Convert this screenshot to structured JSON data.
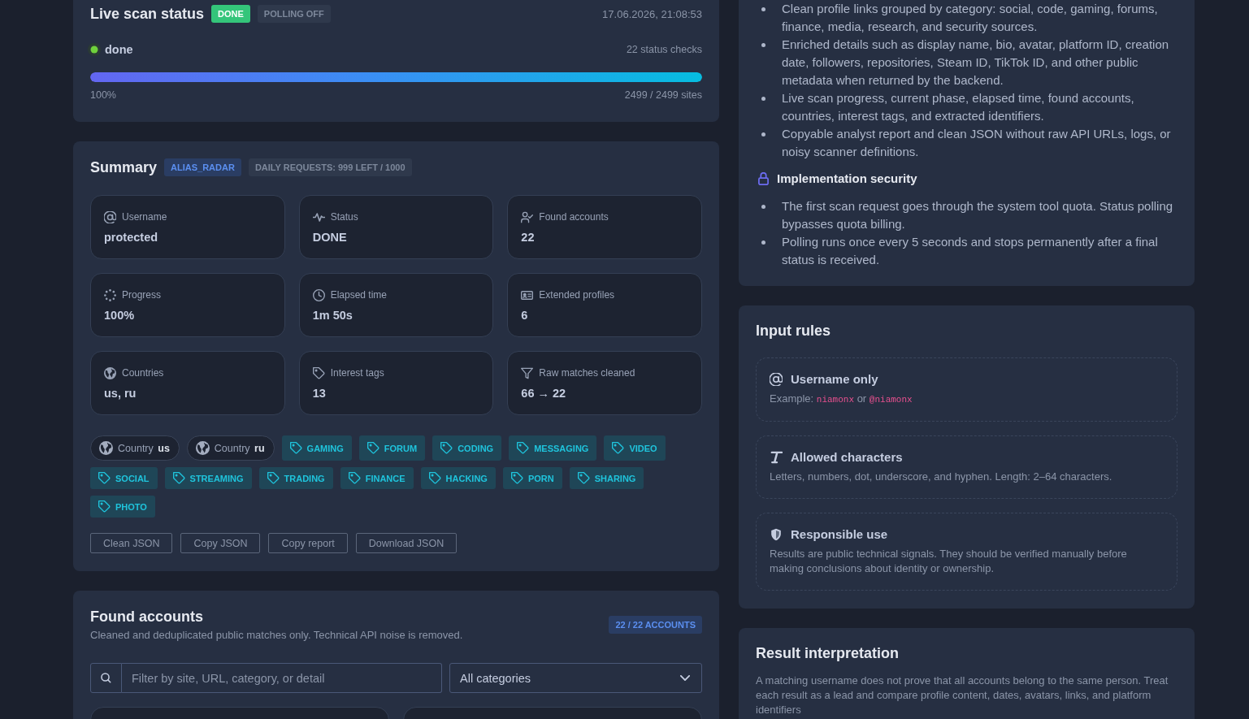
{
  "live_scan_status": {
    "title": "Live scan status",
    "badges": [
      {
        "label": "DONE",
        "kind": "success"
      },
      {
        "label": "POLLING OFF",
        "kind": "muted"
      }
    ],
    "timestamp": "17.06.2026, 21:08:53",
    "status": "done",
    "status_checks": "22 status checks",
    "progress": {
      "level": 1.0,
      "percent": "100%",
      "sites": "2499 / 2499 sites"
    }
  },
  "summary": {
    "title": "Summary",
    "badges": [
      {
        "label": "ALIAS_RADAR",
        "kind": "info"
      },
      {
        "label": "DAILY REQUESTS: 999 LEFT / 1000",
        "kind": "muted"
      }
    ],
    "stats": [
      {
        "label": "Username",
        "value": "protected"
      },
      {
        "label": "Status",
        "value": "DONE"
      },
      {
        "label": "Found accounts",
        "value": "22"
      },
      {
        "label": "Progress",
        "value": "100%"
      },
      {
        "label": "Elapsed time",
        "value": "1m 50s"
      },
      {
        "label": "Extended profiles",
        "value": "6"
      },
      {
        "label": "Countries",
        "value": "us, ru"
      },
      {
        "label": "Interest tags",
        "value": "13"
      },
      {
        "label": "Raw matches cleaned",
        "value": "66 → 22"
      }
    ],
    "chips": [
      {
        "kind": "country",
        "label": "Country",
        "value": "us"
      },
      {
        "kind": "country",
        "label": "Country",
        "value": "ru"
      },
      {
        "kind": "tag",
        "label": "GAMING"
      },
      {
        "kind": "tag",
        "label": "FORUM"
      },
      {
        "kind": "tag",
        "label": "CODING"
      },
      {
        "kind": "tag",
        "label": "MESSAGING"
      },
      {
        "kind": "tag",
        "label": "VIDEO"
      },
      {
        "kind": "tag",
        "label": "SOCIAL"
      },
      {
        "kind": "tag",
        "label": "STREAMING"
      },
      {
        "kind": "tag",
        "label": "TRADING"
      },
      {
        "kind": "tag",
        "label": "FINANCE"
      },
      {
        "kind": "tag",
        "label": "HACKING"
      },
      {
        "kind": "tag",
        "label": "PORN"
      },
      {
        "kind": "tag",
        "label": "SHARING"
      },
      {
        "kind": "tag",
        "label": "PHOTO"
      }
    ],
    "buttons": [
      "Clean JSON",
      "Copy JSON",
      "Copy report",
      "Download JSON"
    ]
  },
  "found_accounts": {
    "title": "Found accounts",
    "subtitle": "Cleaned and deduplicated public matches only. Technical API noise is removed.",
    "count_badge": "22 / 22 ACCOUNTS",
    "search": {
      "placeholder": "Filter by site, URL, category, or detail"
    },
    "category_select": {
      "value": "All categories"
    }
  },
  "features": {
    "items": [
      "Clean profile links grouped by category: social, code, gaming, forums, finance, media, research, and security sources.",
      "Enriched details such as display name, bio, avatar, platform ID, creation date, followers, repositories, Steam ID, TikTok ID, and other public metadata when returned by the backend.",
      "Live scan progress, current phase, elapsed time, found accounts, countries, interest tags, and extracted identifiers.",
      "Copyable analyst report and clean JSON without raw API URLs, logs, or noisy scanner definitions."
    ]
  },
  "implementation_security": {
    "title": "Implementation security",
    "items": [
      "The first scan request goes through the system tool quota. Status polling bypasses quota billing.",
      "Polling runs once every 5 seconds and stops permanently after a final status is received."
    ]
  },
  "input_rules": {
    "title": "Input rules",
    "rules": [
      {
        "title": "Username only",
        "description": [
          {
            "kind": "text",
            "text": "Example: "
          },
          {
            "kind": "code",
            "text": "niamonx"
          },
          {
            "kind": "text",
            "text": " or "
          },
          {
            "kind": "code",
            "text": "@niamonx"
          }
        ]
      },
      {
        "title": "Allowed characters",
        "description": [
          {
            "kind": "text",
            "text": "Letters, numbers, dot, underscore, and hyphen. Length: 2–64 characters."
          }
        ]
      },
      {
        "title": "Responsible use",
        "description": [
          {
            "kind": "text",
            "text": "Results are public technical signals. They should be verified manually before making conclusions about identity or ownership."
          }
        ]
      }
    ]
  },
  "result_interpretation": {
    "title": "Result interpretation",
    "text": "A matching username does not prove that all accounts belong to the same person. Treat each result as a lead and compare profile content, dates, avatars, links, and platform identifiers"
  }
}
